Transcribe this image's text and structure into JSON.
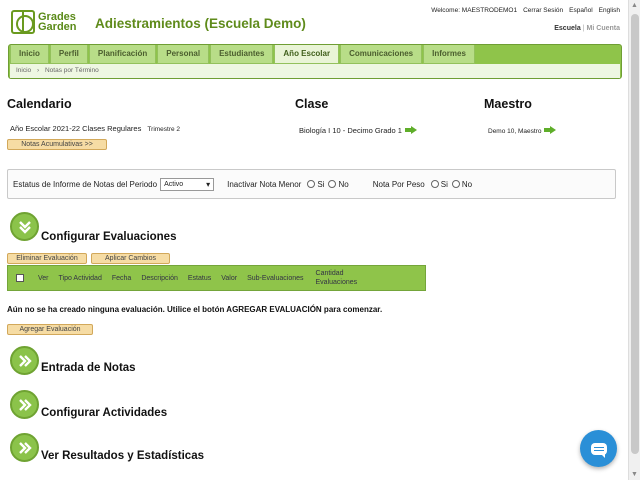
{
  "header": {
    "logo_line1": "Grades",
    "logo_line2": "Garden",
    "app_title": "Adiestramientos (Escuela Demo)",
    "welcome": "Welcome: MAESTRODEMO1",
    "logout": "Cerrar Sesión",
    "lang_es": "Español",
    "lang_en": "English",
    "school_link": "Escuela",
    "account_link": "Mi Cuenta"
  },
  "nav": {
    "tabs": [
      "Inicio",
      "Perfil",
      "Planificación",
      "Personal",
      "Estudiantes",
      "Año Escolar",
      "Comunicaciones",
      "Informes"
    ],
    "active_tab": "Año Escolar",
    "breadcrumb_home": "Inicio",
    "breadcrumb_sep": "›",
    "breadcrumb_current": "Notas por Término"
  },
  "sections": {
    "calendar_title": "Calendario",
    "class_title": "Clase",
    "teacher_title": "Maestro",
    "calendar_info": "Año Escolar 2021-22  Clases Regulares",
    "term": "Trimestre 2",
    "class_info": "Biología I 10 -  Decimo Grado  1",
    "teacher_info": "Demo 10, Maestro",
    "cumulative_btn": "Notas Acumulativas >>"
  },
  "filters": {
    "status_label": "Estatus de Informe de Notas del Periodo",
    "status_value": "Activo",
    "minor_label": "Inactivar Nota Menor",
    "weight_label": "Nota Por Peso",
    "yes": "Si",
    "no": "No"
  },
  "evaluations": {
    "title": "Configurar Evaluaciones",
    "delete_btn": "Eliminar Evaluación",
    "apply_btn": "Aplicar Cambios",
    "columns": [
      "Ver",
      "Tipo Actividad",
      "Fecha",
      "Descripción",
      "Estatus",
      "Valor",
      "Sub-Evaluaciones",
      "Cantidad Evaluaciones"
    ],
    "empty_notice": "Aún no se ha creado ninguna evaluación. Utilice el botón AGREGAR EVALUACIÓN para comenzar.",
    "add_btn": "Agregar Evaluación"
  },
  "other_sections": {
    "grades_entry": "Entrada de Notas",
    "activities": "Configurar Actividades",
    "results": "Ver Resultados y Estadísticas"
  },
  "colors": {
    "brand_green": "#5f8b1b",
    "nav_green": "#8fc44a",
    "button_beige": "#f6dca4",
    "chat_blue": "#2a8fd7"
  }
}
